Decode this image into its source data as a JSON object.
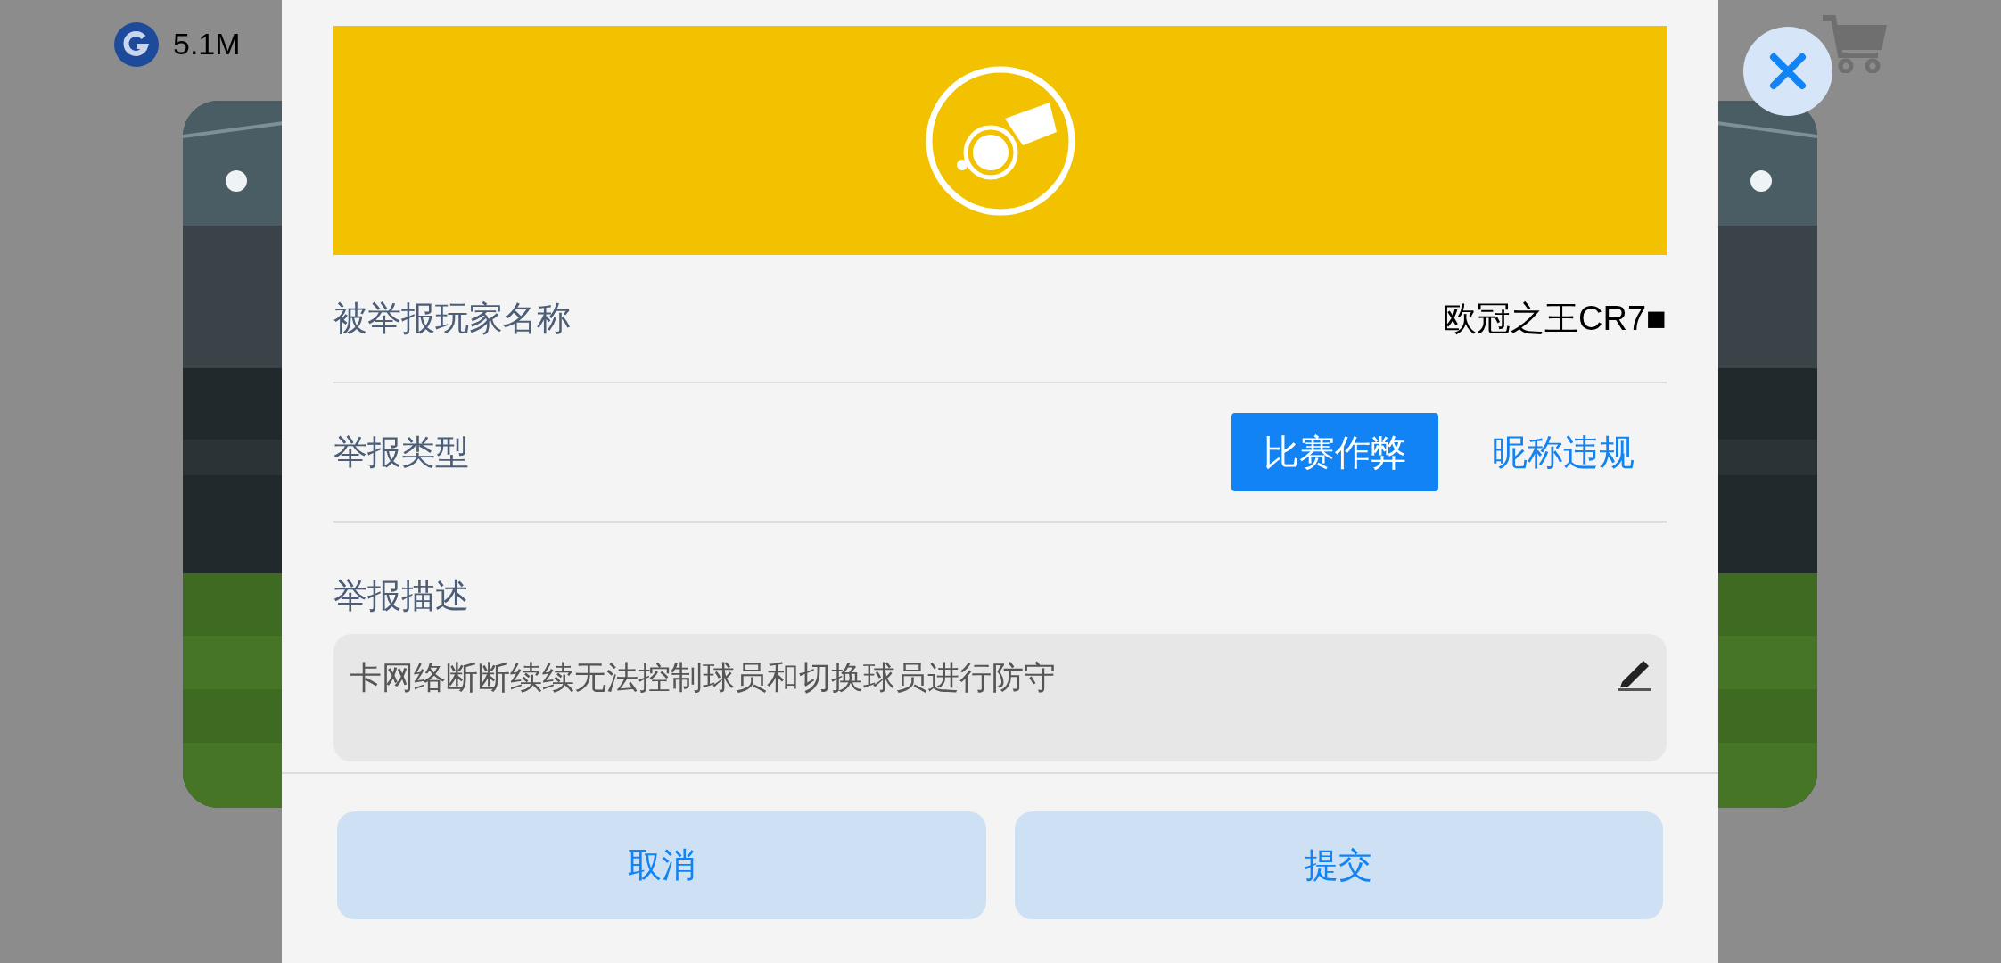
{
  "currency": {
    "amount": "5.1M"
  },
  "report_dialog": {
    "player_name_label": "被举报玩家名称",
    "player_name": "欧冠之王CR7■",
    "type_label": "举报类型",
    "types": [
      {
        "label": "比赛作弊",
        "selected": true
      },
      {
        "label": "昵称违规",
        "selected": false
      }
    ],
    "description_label": "举报描述",
    "description": "卡网络断断续续无法控制球员和切换球员进行防守",
    "buttons": [
      "取消",
      "提交"
    ]
  }
}
